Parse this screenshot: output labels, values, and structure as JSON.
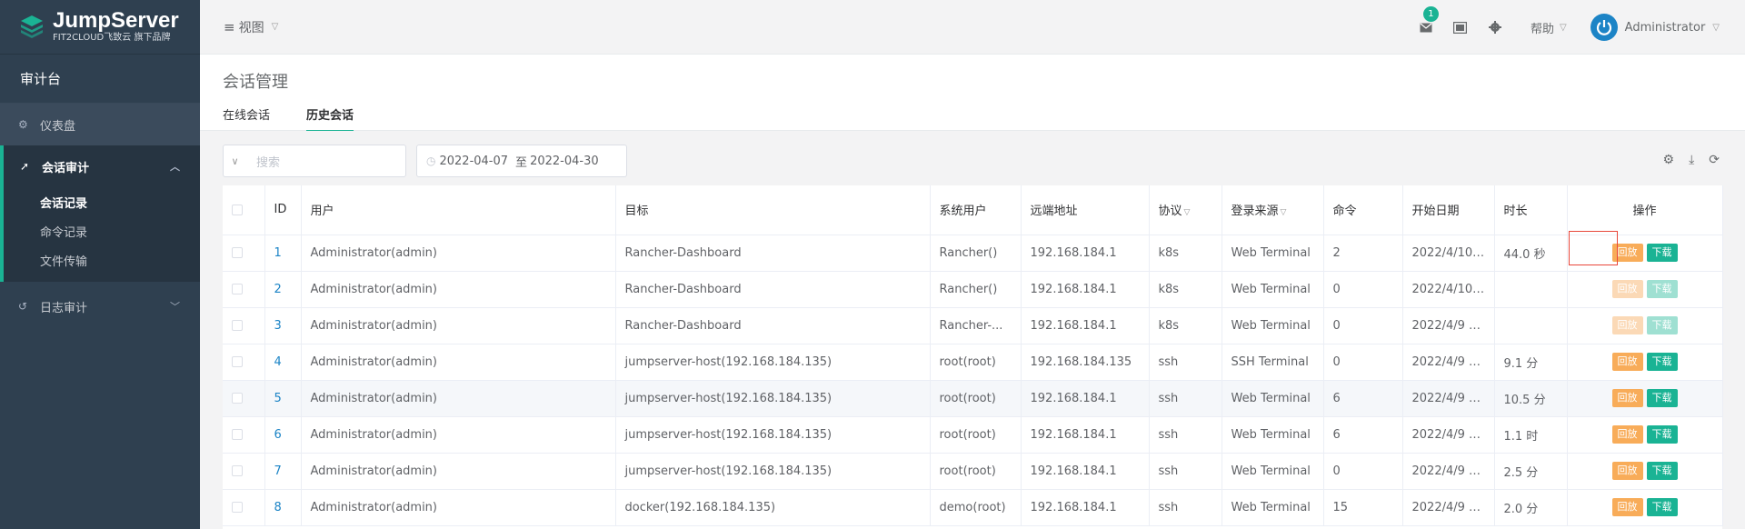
{
  "brand": {
    "title": "JumpServer",
    "subtitle": "FIT2CLOUD飞致云 旗下品牌"
  },
  "sidebar": {
    "console": "审计台",
    "dashboard": "仪表盘",
    "session_audit": "会话审计",
    "sub_items": [
      "会话记录",
      "命令记录",
      "文件传输"
    ],
    "log_audit": "日志审计"
  },
  "header": {
    "view": "视图",
    "mail_badge": "1",
    "help": "帮助",
    "user": "Administrator"
  },
  "page": {
    "title": "会话管理",
    "tabs": [
      "在线会话",
      "历史会话"
    ]
  },
  "filters": {
    "search_placeholder": "搜索",
    "date_from": "2022-04-07",
    "date_sep": "至",
    "date_to": "2022-04-30"
  },
  "table": {
    "columns": [
      "ID",
      "用户",
      "目标",
      "系统用户",
      "远端地址",
      "协议",
      "登录来源",
      "命令",
      "开始日期",
      "时长",
      "操作"
    ],
    "replay_label": "回放",
    "download_label": "下载",
    "rows": [
      {
        "id": "1",
        "user": "Administrator(admin)",
        "target": "Rancher-Dashboard",
        "sysuser": "Rancher()",
        "addr": "192.168.184.1",
        "proto": "k8s",
        "source": "Web Terminal",
        "cmds": "2",
        "start": "2022/4/10 ...",
        "dur": "44.0 秒",
        "enabled": true
      },
      {
        "id": "2",
        "user": "Administrator(admin)",
        "target": "Rancher-Dashboard",
        "sysuser": "Rancher()",
        "addr": "192.168.184.1",
        "proto": "k8s",
        "source": "Web Terminal",
        "cmds": "0",
        "start": "2022/4/10 ...",
        "dur": "",
        "enabled": false
      },
      {
        "id": "3",
        "user": "Administrator(admin)",
        "target": "Rancher-Dashboard",
        "sysuser": "Rancher-...",
        "addr": "192.168.184.1",
        "proto": "k8s",
        "source": "Web Terminal",
        "cmds": "0",
        "start": "2022/4/9 2...",
        "dur": "",
        "enabled": false
      },
      {
        "id": "4",
        "user": "Administrator(admin)",
        "target": "jumpserver-host(192.168.184.135)",
        "sysuser": "root(root)",
        "addr": "192.168.184.135",
        "proto": "ssh",
        "source": "SSH Terminal",
        "cmds": "0",
        "start": "2022/4/9 2...",
        "dur": "9.1 分",
        "enabled": true
      },
      {
        "id": "5",
        "user": "Administrator(admin)",
        "target": "jumpserver-host(192.168.184.135)",
        "sysuser": "root(root)",
        "addr": "192.168.184.1",
        "proto": "ssh",
        "source": "Web Terminal",
        "cmds": "6",
        "start": "2022/4/9 2...",
        "dur": "10.5 分",
        "enabled": true
      },
      {
        "id": "6",
        "user": "Administrator(admin)",
        "target": "jumpserver-host(192.168.184.135)",
        "sysuser": "root(root)",
        "addr": "192.168.184.1",
        "proto": "ssh",
        "source": "Web Terminal",
        "cmds": "6",
        "start": "2022/4/9 2...",
        "dur": "1.1 时",
        "enabled": true
      },
      {
        "id": "7",
        "user": "Administrator(admin)",
        "target": "jumpserver-host(192.168.184.135)",
        "sysuser": "root(root)",
        "addr": "192.168.184.1",
        "proto": "ssh",
        "source": "Web Terminal",
        "cmds": "0",
        "start": "2022/4/9 2...",
        "dur": "2.5 分",
        "enabled": true
      },
      {
        "id": "8",
        "user": "Administrator(admin)",
        "target": "docker(192.168.184.135)",
        "sysuser": "demo(root)",
        "addr": "192.168.184.1",
        "proto": "ssh",
        "source": "Web Terminal",
        "cmds": "15",
        "start": "2022/4/9 2...",
        "dur": "2.0 分",
        "enabled": true
      }
    ]
  },
  "colors": {
    "accent": "#1ab394",
    "warning": "#f8ac59",
    "sidebar": "#2f4050",
    "link": "#1c84c6"
  }
}
